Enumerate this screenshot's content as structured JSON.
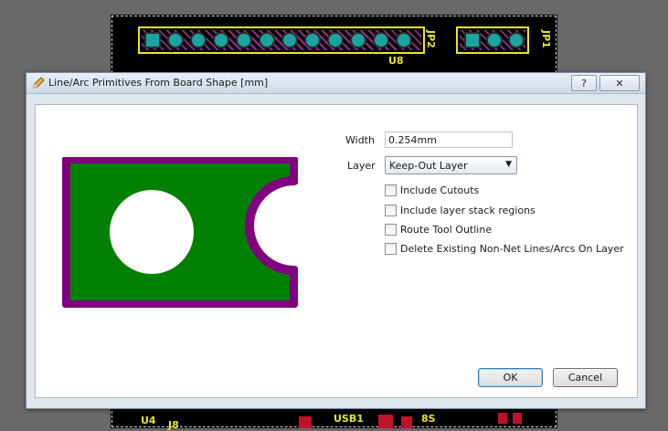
{
  "background": {
    "labels": [
      "JP2",
      "JP1",
      "U8",
      "U4",
      "J8",
      "USB1",
      "8S"
    ]
  },
  "dialog": {
    "title": "Line/Arc Primitives From Board Shape [mm]",
    "help_button": "?",
    "close_button": "✕",
    "width_label": "Width",
    "width_value": "0.254mm",
    "layer_label": "Layer",
    "layer_value": "Keep-Out Layer",
    "checkboxes": [
      {
        "label": "Include Cutouts",
        "checked": false
      },
      {
        "label": "Include layer stack regions",
        "checked": false
      },
      {
        "label": "Route Tool Outline",
        "checked": false
      },
      {
        "label": "Delete Existing Non-Net Lines/Arcs On Layer",
        "checked": false
      }
    ],
    "ok_label": "OK",
    "cancel_label": "Cancel"
  },
  "colors": {
    "board_fill": "#008000",
    "board_outline": "#800080",
    "silk": "#e6e628",
    "pad": "#1aa3a0"
  }
}
